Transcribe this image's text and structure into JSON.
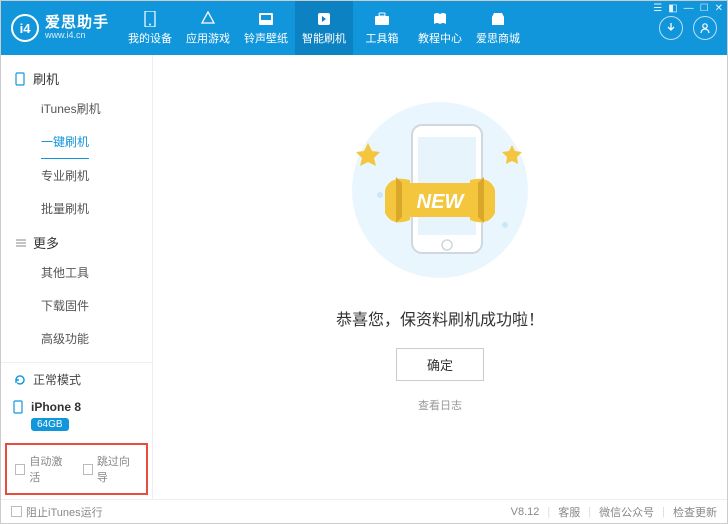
{
  "logo": {
    "mark": "i4",
    "main": "爱思助手",
    "sub": "www.i4.cn"
  },
  "tabs": [
    {
      "label": "我的设备"
    },
    {
      "label": "应用游戏"
    },
    {
      "label": "铃声壁纸"
    },
    {
      "label": "智能刷机"
    },
    {
      "label": "工具箱"
    },
    {
      "label": "教程中心"
    },
    {
      "label": "爱思商城"
    }
  ],
  "sidebar": {
    "section1": {
      "title": "刷机",
      "items": [
        "iTunes刷机",
        "一键刷机",
        "专业刷机",
        "批量刷机"
      ]
    },
    "section2": {
      "title": "更多",
      "items": [
        "其他工具",
        "下载固件",
        "高级功能"
      ]
    },
    "mode": "正常模式",
    "device": "iPhone 8",
    "storage": "64GB",
    "chk1": "自动激活",
    "chk2": "跳过向导"
  },
  "main": {
    "banner": "NEW",
    "congrats": "恭喜您，保资料刷机成功啦！",
    "ok": "确定",
    "viewlog": "查看日志"
  },
  "footer": {
    "block_itunes": "阻止iTunes运行",
    "version": "V8.12",
    "support": "客服",
    "wechat": "微信公众号",
    "update": "检查更新"
  }
}
